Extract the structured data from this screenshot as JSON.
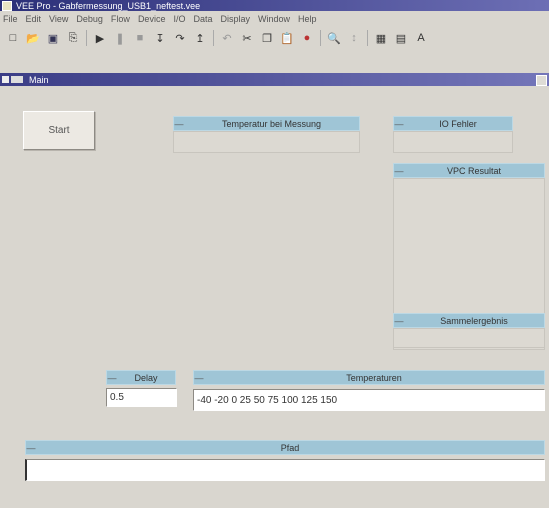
{
  "window": {
    "title": "VEE Pro - Gabfermessung_USB1_neftest.vee"
  },
  "menubar": [
    "File",
    "Edit",
    "View",
    "Debug",
    "Flow",
    "Device",
    "I/O",
    "Data",
    "Display",
    "Window",
    "Help"
  ],
  "toolbar": {
    "icons": [
      "new-icon",
      "open-icon",
      "save-icon",
      "print-icon",
      "run-icon",
      "pause-icon",
      "stop-icon",
      "step-into-icon",
      "step-over-icon",
      "step-out-icon",
      "undo-icon",
      "cut-icon",
      "copy-icon",
      "paste-icon",
      "find-icon",
      "zoom-icon",
      "properties-icon",
      "other-icon"
    ]
  },
  "main_window": {
    "title": "Main"
  },
  "start_button": {
    "label": "Start"
  },
  "panels": {
    "temperatur_messung": {
      "label": "Temperatur bei Messung"
    },
    "io_fehler": {
      "label": "IO Fehler"
    },
    "vpc_resultat": {
      "label": "VPC Resultat"
    },
    "sammelergebnis": {
      "label": "Sammelergebnis"
    },
    "delay": {
      "label": "Delay",
      "value": "0.5"
    },
    "temperaturen": {
      "label": "Temperaturen",
      "value": "-40 -20 0 25 50 75 100 125 150"
    },
    "pfad": {
      "label": "Pfad",
      "value": ""
    }
  }
}
